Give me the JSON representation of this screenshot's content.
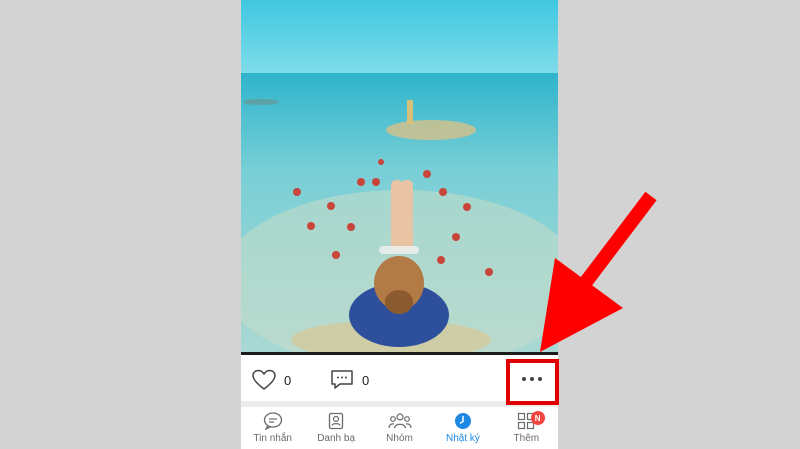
{
  "post": {
    "like_count": "0",
    "comment_count": "0"
  },
  "tabs": [
    {
      "label": "Tin nhắn",
      "icon": "chat-bubble-icon"
    },
    {
      "label": "Danh bạ",
      "icon": "contacts-icon"
    },
    {
      "label": "Nhóm",
      "icon": "group-icon"
    },
    {
      "label": "Nhật ký",
      "icon": "clock-icon",
      "active": true
    },
    {
      "label": "Thêm",
      "icon": "grid-icon",
      "badge": "N"
    }
  ],
  "colors": {
    "active_tab": "#1e88e5",
    "badge": "#f2453d",
    "annotation": "#e00000"
  }
}
